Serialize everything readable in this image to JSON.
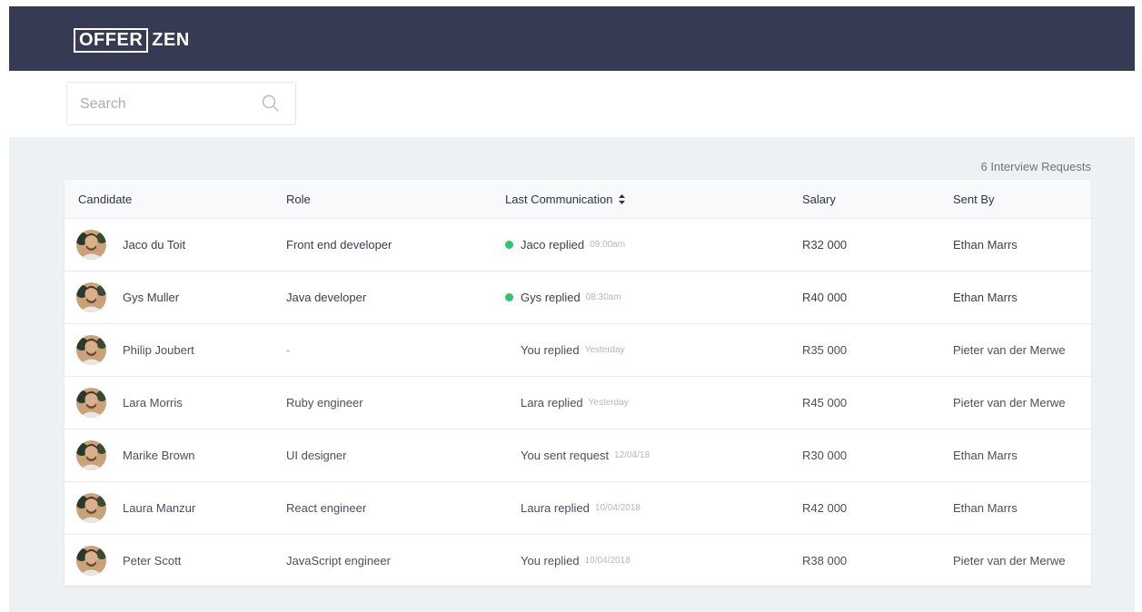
{
  "brand": {
    "logo_boxed": "OFFER",
    "logo_plain": "ZEN",
    "header_color": "#363a52"
  },
  "search": {
    "placeholder": "Search",
    "value": "",
    "icon": "search-icon"
  },
  "summary": {
    "count_label": "6 Interview Requests"
  },
  "table": {
    "columns": [
      "Candidate",
      "Role",
      "Last Communication",
      "Salary",
      "Sent By"
    ],
    "sort_icon": "sort-icon",
    "accent_dot_color": "#32c36c",
    "rows": [
      {
        "candidate": "Jaco du Toit",
        "role": "Front end developer",
        "comm": "Jaco replied",
        "time": "09:00am",
        "unread": true,
        "salary": "R32 000",
        "sent_by": "Ethan Marrs"
      },
      {
        "candidate": "Gys Muller",
        "role": "Java developer",
        "comm": "Gys replied",
        "time": "08:30am",
        "unread": true,
        "salary": "R40 000",
        "sent_by": "Ethan Marrs"
      },
      {
        "candidate": "Philip Joubert",
        "role": "-",
        "comm": "You replied",
        "time": "Yesterday",
        "unread": false,
        "salary": "R35 000",
        "sent_by": "Pieter van der Merwe"
      },
      {
        "candidate": "Lara Morris",
        "role": "Ruby engineer",
        "comm": "Lara replied",
        "time": "Yesterday",
        "unread": false,
        "salary": "R45 000",
        "sent_by": "Pieter van der Merwe"
      },
      {
        "candidate": "Marike Brown",
        "role": "UI designer",
        "comm": "You sent request",
        "time": "12/04/18",
        "unread": false,
        "salary": "R30 000",
        "sent_by": "Ethan Marrs"
      },
      {
        "candidate": "Laura Manzur",
        "role": "React engineer",
        "comm": "Laura replied",
        "time": "10/04/2018",
        "unread": false,
        "salary": "R42 000",
        "sent_by": "Ethan Marrs"
      },
      {
        "candidate": "Peter Scott",
        "role": "JavaScript engineer",
        "comm": "You replied",
        "time": "10/04/2018",
        "unread": false,
        "salary": "R38 000",
        "sent_by": "Pieter van der Merwe"
      }
    ]
  }
}
